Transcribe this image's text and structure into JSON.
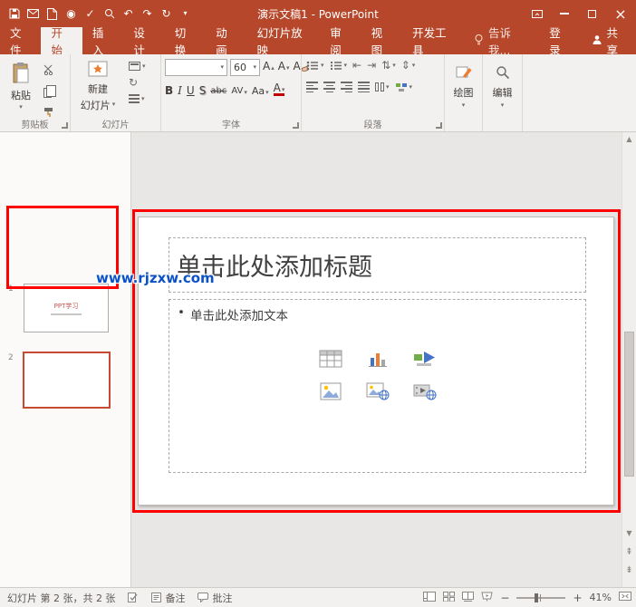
{
  "colors": {
    "accent": "#B7472A",
    "annotation": "#FF0000",
    "watermark": "#0B52C8"
  },
  "titlebar": {
    "title": "演示文稿1 - PowerPoint",
    "qat_icons": [
      "save",
      "email",
      "new-file",
      "touch-mode",
      "spellcheck",
      "search",
      "undo",
      "redo",
      "refresh"
    ]
  },
  "tabs": {
    "file": "文件",
    "home": "开始",
    "insert": "插入",
    "design": "设计",
    "transitions": "切换",
    "animations": "动画",
    "slideshow": "幻灯片放映",
    "review": "审阅",
    "view": "视图",
    "developer": "开发工具",
    "tell_me": "告诉我...",
    "sign_in": "登录",
    "share": "共享"
  },
  "ribbon": {
    "clipboard": {
      "paste": "粘贴",
      "group": "剪贴板"
    },
    "slides": {
      "new_line1": "新建",
      "new_line2": "幻灯片",
      "group": "幻灯片"
    },
    "font": {
      "name": "",
      "size": "60",
      "grow": "A",
      "shrink": "A",
      "clear": "A",
      "bold": "B",
      "italic": "I",
      "underline": "U",
      "shadow": "S",
      "strike": "abc",
      "spacing": "AV",
      "case": "Aa",
      "color": "A",
      "group": "字体"
    },
    "paragraph": {
      "group": "段落"
    },
    "drawing": {
      "label": "绘图"
    },
    "editing": {
      "label": "编辑"
    }
  },
  "thumbnails": {
    "slide1_number": "1",
    "slide1_title": "PPT学习",
    "slide2_number": "2"
  },
  "watermark": "www.rjzxw.com",
  "slide": {
    "title_placeholder": "单击此处添加标题",
    "bullet": "•",
    "body_placeholder": "单击此处添加文本"
  },
  "statusbar": {
    "slide_info": "幻灯片 第 2 张，共 2 张",
    "notes": "备注",
    "comments": "批注",
    "zoom_out": "−",
    "zoom_in": "+",
    "zoom": "41%"
  },
  "icons": {
    "caret": "▾",
    "caret_up": "▴",
    "undo": "↶",
    "redo": "↷",
    "refresh": "↻",
    "check": "✓",
    "touch": "◉",
    "indent_decrease": "⇤",
    "indent_increase": "⇥",
    "text_direction": "⇅",
    "line_spacing": "⇕",
    "scroll_up": "▲",
    "scroll_down": "▼",
    "prev_slide": "⇞",
    "next_slide": "⇟",
    "close": "×"
  }
}
